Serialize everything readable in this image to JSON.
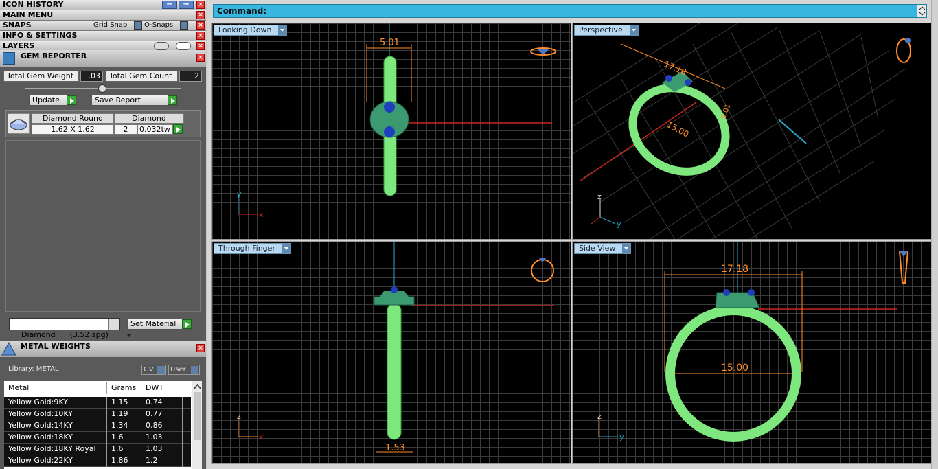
{
  "menu": {
    "icon_history": "ICON HISTORY",
    "main_menu": "MAIN MENU",
    "snaps": "SNAPS",
    "grid_snap": "Grid Snap",
    "o_snaps": "O-Snaps",
    "info_settings": "INFO & SETTINGS",
    "layers": "LAYERS"
  },
  "gem_reporter": {
    "title": "GEM REPORTER",
    "total_weight_label": "Total Gem Weight",
    "total_weight": ".03",
    "total_count_label": "Total Gem Count",
    "total_count": "2",
    "update_label": "Update",
    "save_report_label": "Save Report",
    "gem": {
      "shape": "Diamond Round",
      "type": "Diamond",
      "size": "1.62 X 1.62",
      "count": "2",
      "weight": "0.032tw"
    },
    "material_select": "Diamond      (3.52 spg)",
    "set_material_label": "Set Material"
  },
  "metal_weights": {
    "title": "METAL WEIGHTS",
    "library": "Library: METAL",
    "gv_label": "GV",
    "user_label": "User",
    "columns": [
      "Metal",
      "Grams",
      "DWT"
    ],
    "rows": [
      [
        "Yellow Gold:9KY",
        "1.15",
        "0.74"
      ],
      [
        "Yellow Gold:10KY",
        "1.19",
        "0.77"
      ],
      [
        "Yellow Gold:14KY",
        "1.34",
        "0.86"
      ],
      [
        "Yellow Gold:18KY",
        "1.6",
        "1.03"
      ],
      [
        "Yellow Gold:18KY Royal",
        "1.6",
        "1.03"
      ],
      [
        "Yellow Gold:22KY",
        "1.86",
        "1.2"
      ]
    ]
  },
  "command": {
    "label": "Command:"
  },
  "viewports": {
    "top_left": {
      "name": "Looking Down",
      "dimension": "5.01"
    },
    "top_right": {
      "name": "Perspective",
      "dim_a": "17.18",
      "dim_b": "15.00",
      "dim_c": "5.01"
    },
    "bottom_left": {
      "name": "Through Finger",
      "dimension": "1.53"
    },
    "bottom_right": {
      "name": "Side View",
      "dim_outer": "17.18",
      "dim_inner": "15.00"
    }
  },
  "colors": {
    "ring": "#7ee87e",
    "dimension": "#ff8c2a",
    "axis_red": "#c8261c",
    "axis_cyan": "#2aa8c8",
    "command_bar": "#38b6e0"
  }
}
